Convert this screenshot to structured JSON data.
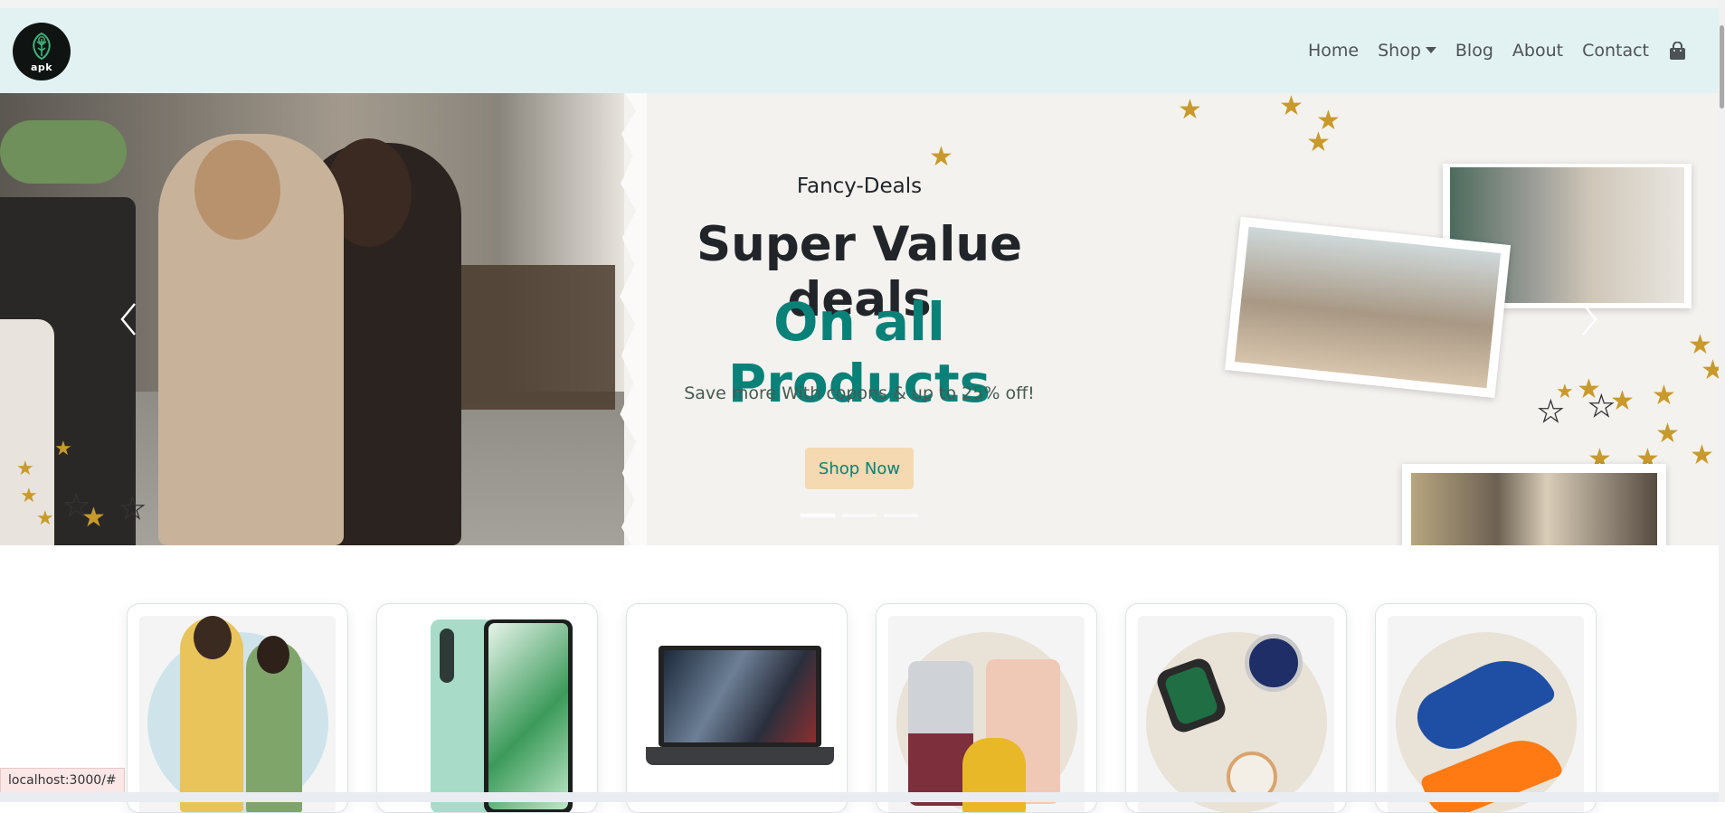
{
  "logo": {
    "text": "apk"
  },
  "nav": {
    "items": [
      {
        "label": "Home"
      },
      {
        "label": "Shop"
      },
      {
        "label": "Blog"
      },
      {
        "label": "About"
      },
      {
        "label": "Contact"
      }
    ],
    "cart_icon": "shopping-bag-icon"
  },
  "hero": {
    "kicker": "Fancy-Deals",
    "title": "Super Value deals",
    "subtitle": "On all Products",
    "description": "Save more With copons & up to 25% off!",
    "button_label": "Shop Now",
    "slide_count": 3,
    "active_slide": 1,
    "prev_icon": "chevron-left-icon",
    "next_icon": "chevron-right-icon"
  },
  "categories": [
    {
      "image": "fashion-couple"
    },
    {
      "image": "smartphone"
    },
    {
      "image": "laptop"
    },
    {
      "image": "luggage"
    },
    {
      "image": "watches"
    },
    {
      "image": "shoes"
    }
  ],
  "status_bar": {
    "url": "localhost:3000/#"
  },
  "colors": {
    "accent": "#088178",
    "navbar_bg": "#e2f2f2",
    "button_bg": "#f5d9b1",
    "hero_bg": "#f4f2ef"
  }
}
